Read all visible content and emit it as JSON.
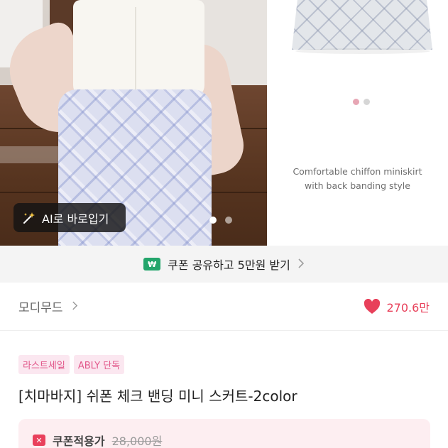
{
  "gallery": {
    "ai_button_label": "AI로 바로입기",
    "side_caption_line1": "Comfortable chiffon miniskirt",
    "side_caption_line2": "with back banding style"
  },
  "coupon_banner": {
    "icon_text": "₩",
    "text": "쿠폰 공유하고 5만원 받기"
  },
  "brand": {
    "name": "모디무드",
    "likes": "270.6만"
  },
  "product": {
    "badges": [
      "라스트세일",
      "ABLY 단독"
    ],
    "title": "[치마바지] 쉬폰 체크 밴딩 미니 스커트-2color",
    "price_label": "쿠폰적용가",
    "original_price": "28,000원"
  },
  "colors": {
    "accent_pink": "#e8405a",
    "badge_bg": "#fbe7f0",
    "coupon_green": "#23a56b"
  },
  "icons": [
    "wand-icon",
    "won-icon",
    "chevron-right-icon",
    "heart-icon",
    "coupon-icon"
  ]
}
